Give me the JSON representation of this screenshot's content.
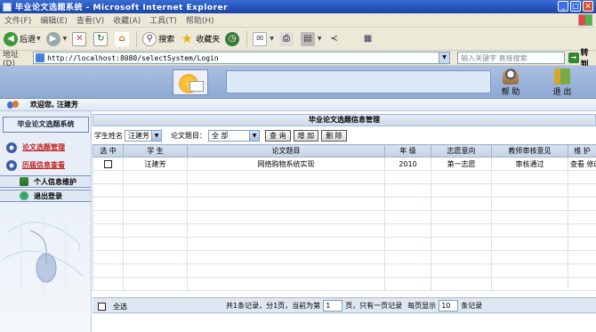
{
  "window": {
    "title": "毕业论文选题系统 - Microsoft Internet Explorer"
  },
  "menu": [
    "文件(F)",
    "编辑(E)",
    "查看(V)",
    "收藏(A)",
    "工具(T)",
    "帮助(H)"
  ],
  "toolbar": {
    "back": "后退",
    "search": "搜索",
    "favorites": "收藏夹"
  },
  "address": {
    "label": "地址(D)",
    "url": "http://localhost:8080/selectSystem/Login",
    "keyword_placeholder": "输入关键字 直接搜索",
    "go": "转到"
  },
  "banner": {
    "help": "帮 助",
    "exit": "退 出"
  },
  "welcome": "欢迎您, 汪建芳",
  "sidebar": {
    "title": "毕业论文选题系统",
    "items": [
      {
        "label": "论文选题管理"
      },
      {
        "label": "历届信息查看"
      }
    ],
    "bars": [
      {
        "label": "个人信息维护"
      },
      {
        "label": "退出登录"
      }
    ]
  },
  "main": {
    "title": "毕业论文选题信息管理",
    "filters": {
      "student_label": "学生姓名",
      "student_value": "汪建芳",
      "topic_label": "论文题目：",
      "topic_value": "全 部",
      "query": "查 询",
      "add": "增 加",
      "delete": "删 除"
    },
    "columns": [
      "选 中",
      "学 生",
      "论文题目",
      "年 级",
      "志愿意向",
      "教师审核意见",
      "维 护"
    ],
    "rows": [
      {
        "student": "汪建芳",
        "topic": "网络购物系统实现",
        "grade": "2010",
        "intent": "第一志愿",
        "review": "审核通过",
        "actions": "查看 修改"
      }
    ],
    "footer": {
      "select_all": "全选",
      "summary": "共1条记录，分1页，当前为第",
      "page": "1",
      "summary2": "页，只有一页记录",
      "per_page_label": "每页显示",
      "per_page": "10",
      "per_page_unit": "条记录"
    }
  }
}
